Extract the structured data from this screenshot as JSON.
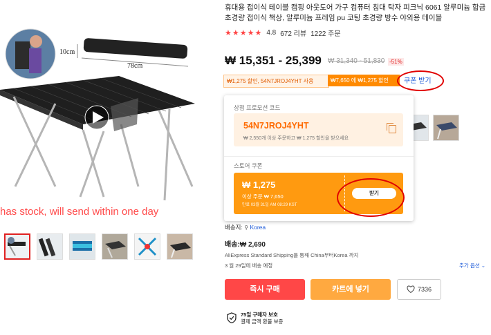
{
  "gallery": {
    "overlay_text": "has stock, will send within one day",
    "dim_height": "10cm",
    "dim_width": "78cm",
    "thumbnail_count": 6
  },
  "product": {
    "title": "휴대용 접이식 테이블 캠핑 아웃도어 가구 컴퓨터 침대 탁자 피크닉 6061 알루미늄 합금 초경량 접이식 책상, 알루미늄 프레임 pu 코팅 초경량 방수 야외용 테이블",
    "stars": "★★★★★",
    "rating": "4.8",
    "reviews": "672 리뷰",
    "orders": "1222 주문",
    "price": "₩ 15,351 - 25,399",
    "original_price": "₩ 31,340 - 51,830",
    "discount": "-51%"
  },
  "promo_tags": {
    "tag1": "₩1,275 할인, 54N7JROJ4YHT 사용",
    "tag2": "₩7,650 에 ₩1,275 할인",
    "coupon_link": "쿠폰 받기"
  },
  "popup": {
    "store_promo_label": "상점 프로모션 코드",
    "code": "54N7JROJ4YHT",
    "code_desc": "₩ 2,550개 이상 주문하고 ₩ 1,275 할인을 받으세요",
    "store_coupon_label": "스토어 쿠폰",
    "coupon_amount": "₩ 1,275",
    "coupon_condition": "이상 주문 ₩ 7,650",
    "coupon_expiry": "만료 03월 31일 AM 08:29 KST",
    "claim_button": "받기"
  },
  "shipping": {
    "ship_to_label": "배송지:",
    "ship_to_location": "Korea",
    "fee": "배송:₩ 2,690",
    "method": "AliExpress Standard Shipping를 통해 China부터Korea 까지",
    "delivery": "3 월 29일에 배송 예정",
    "more_options": "추가 옵션 ⌄"
  },
  "actions": {
    "buy_now": "즉시 구매",
    "add_to_cart": "카트에 넣기",
    "wishlist_count": "7336"
  },
  "protection": {
    "line1": "75일 구매자 보호",
    "line2": "결제 금액 환불 보증"
  },
  "colors": {
    "accent_red": "#ff4747",
    "accent_orange": "#ffa940",
    "link_blue": "#1a58d8",
    "annotation_red": "#e00000"
  }
}
